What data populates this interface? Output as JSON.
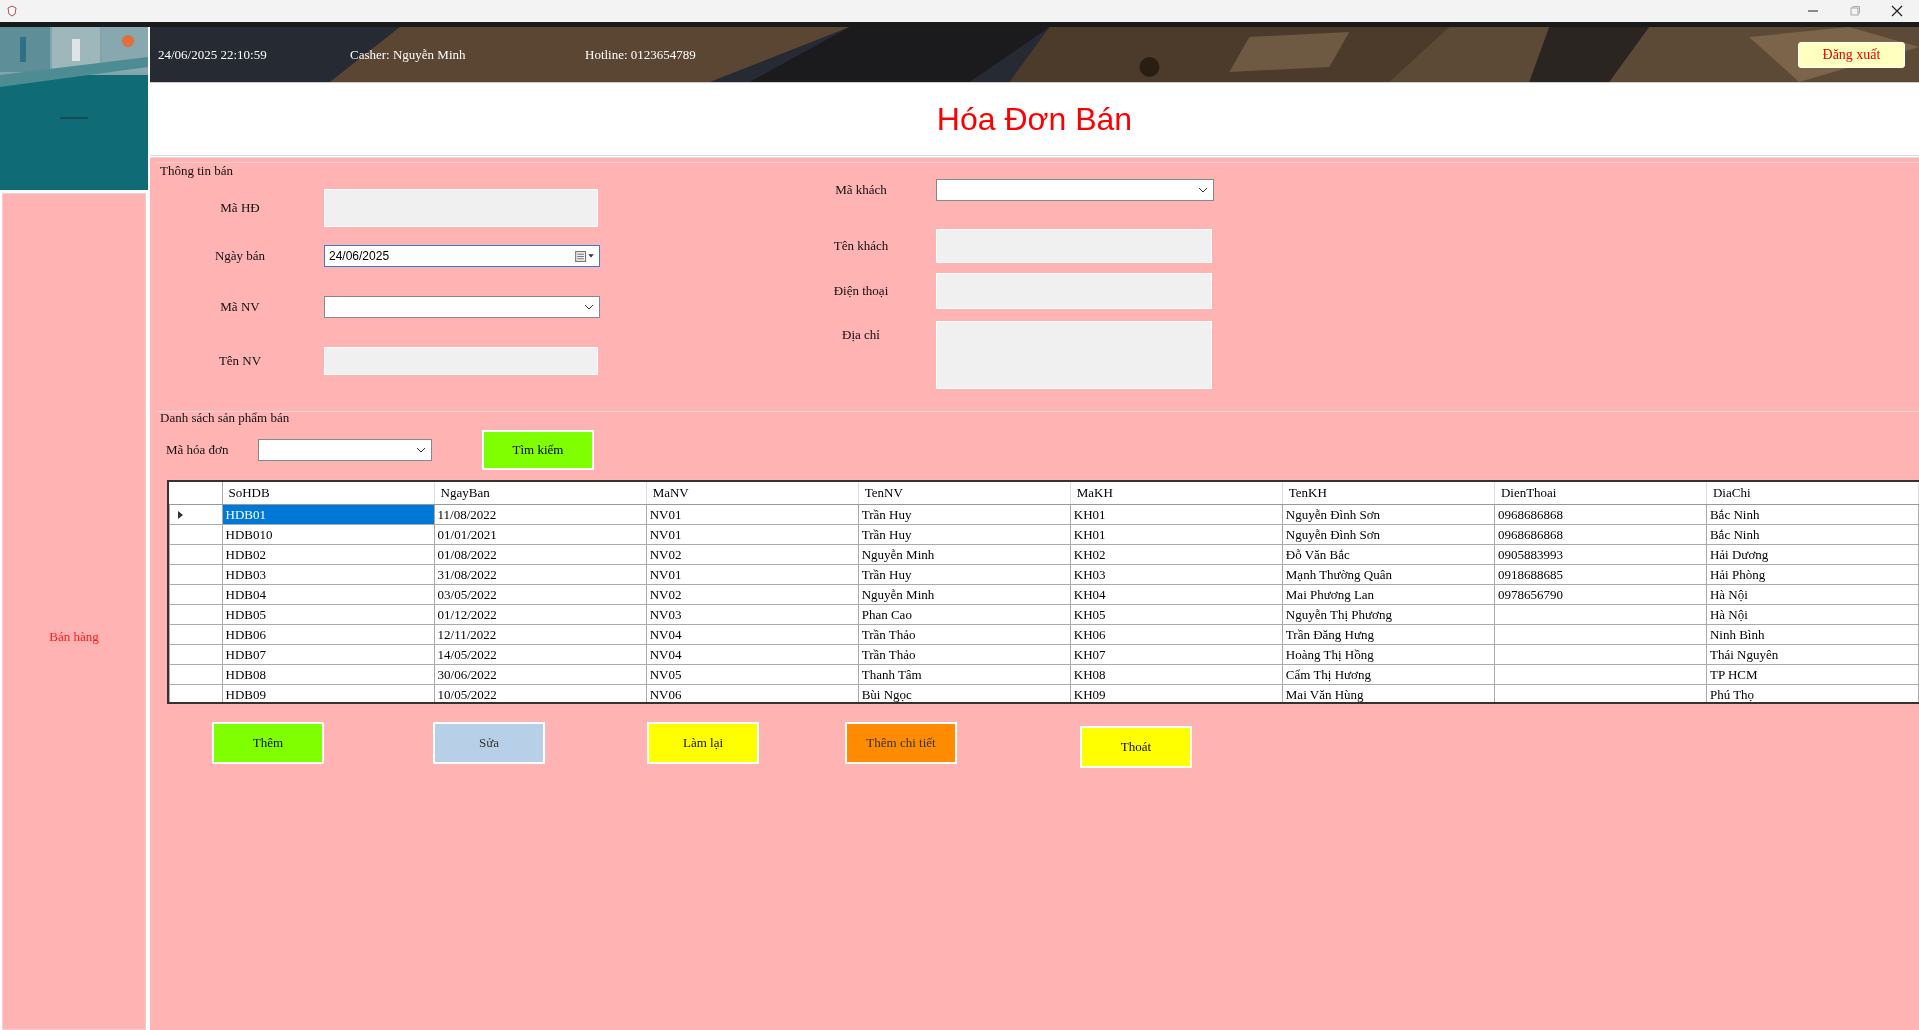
{
  "header": {
    "datetime": "24/06/2025 22:10:59",
    "cashier": "Casher: Nguyễn Minh",
    "hotline": "Hotline: 0123654789",
    "logout": "Đăng xuất"
  },
  "sidebar": {
    "items": [
      {
        "label": "Bán hàng",
        "selected": true
      }
    ]
  },
  "title": "Hóa Đơn Bán",
  "info_group": {
    "title": "Thông tin bán",
    "left_fields": [
      {
        "label": "Mã HĐ",
        "kind": "text"
      },
      {
        "label": "Ngày bán",
        "kind": "date",
        "value": "24/06/2025"
      },
      {
        "label": "Mã NV",
        "kind": "combo"
      },
      {
        "label": "Tên NV",
        "kind": "text"
      }
    ],
    "right_fields": [
      {
        "label": "Mã khách",
        "kind": "combo"
      },
      {
        "label": "Tên khách",
        "kind": "text"
      },
      {
        "label": "Điện thoại",
        "kind": "text"
      },
      {
        "label": "Địa chỉ",
        "kind": "textarea"
      }
    ]
  },
  "list_group": {
    "title": "Danh sách sản phẩm bán",
    "filter_label": "Mã hóa đơn",
    "search_button": "Tìm kiếm"
  },
  "table": {
    "columns": [
      "SoHDB",
      "NgayBan",
      "MaNV",
      "TenNV",
      "MaKH",
      "TenKH",
      "DienThoai",
      "DiaChi"
    ],
    "rows": [
      {
        "cells": [
          "HDB01",
          "11/08/2022",
          "NV01",
          "Trần Huy",
          "KH01",
          "Nguyễn Đình Sơn",
          "0968686868",
          "Bắc Ninh"
        ],
        "selected": true
      },
      {
        "cells": [
          "HDB010",
          "01/01/2021",
          "NV01",
          "Trần Huy",
          "KH01",
          "Nguyễn Đình Sơn",
          "0968686868",
          "Bắc Ninh"
        ],
        "selected": false
      },
      {
        "cells": [
          "HDB02",
          "01/08/2022",
          "NV02",
          "Nguyễn Minh",
          "KH02",
          "Đỗ Văn Bắc",
          "0905883993",
          "Hải Dương"
        ],
        "selected": false
      },
      {
        "cells": [
          "HDB03",
          "31/08/2022",
          "NV01",
          "Trần Huy",
          "KH03",
          "Mạnh Thường Quân",
          "0918688685",
          "Hải Phòng"
        ],
        "selected": false
      },
      {
        "cells": [
          "HDB04",
          "03/05/2022",
          "NV02",
          "Nguyễn Minh",
          "KH04",
          "Mai Phương Lan",
          "0978656790",
          "Hà Nội"
        ],
        "selected": false
      },
      {
        "cells": [
          "HDB05",
          "01/12/2022",
          "NV03",
          "Phan Cao",
          "KH05",
          "Nguyễn Thị Phương",
          "",
          "Hà Nội"
        ],
        "selected": false
      },
      {
        "cells": [
          "HDB06",
          "12/11/2022",
          "NV04",
          "Trần Thảo",
          "KH06",
          "Trần Đăng Hưng",
          "",
          "Ninh Bình"
        ],
        "selected": false
      },
      {
        "cells": [
          "HDB07",
          "14/05/2022",
          "NV04",
          "Trần Thảo",
          "KH07",
          "Hoàng Thị Hồng",
          "",
          "Thái Nguyên"
        ],
        "selected": false
      },
      {
        "cells": [
          "HDB08",
          "30/06/2022",
          "NV05",
          "Thanh Tâm",
          "KH08",
          "Cẩm Thị Hương",
          "",
          "TP HCM"
        ],
        "selected": false
      },
      {
        "cells": [
          "HDB09",
          "10/05/2022",
          "NV06",
          "Bùi Ngọc",
          "KH09",
          "Mai Văn Hùng",
          "",
          "Phú Thọ"
        ],
        "selected": false
      }
    ]
  },
  "buttons": [
    {
      "label": "Thêm",
      "color": "#80ff00"
    },
    {
      "label": "Sửa",
      "color": "#b8cfe8"
    },
    {
      "label": "Làm lại",
      "color": "#ffff00"
    },
    {
      "label": "Thêm chi tiết",
      "color": "#ff8c00"
    },
    {
      "label": "Thoát",
      "color": "#ffff00"
    }
  ]
}
